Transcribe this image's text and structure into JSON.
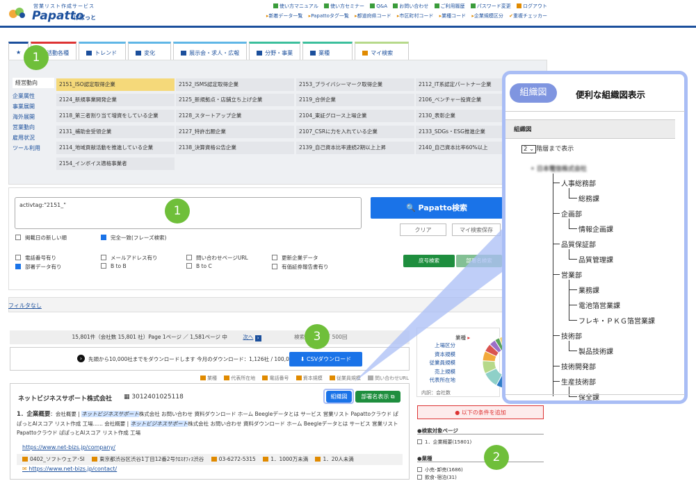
{
  "header": {
    "logo_sub": "営業リスト作成サービス",
    "logo_text": "Papatto",
    "logo_kana": "ぱぱっと",
    "links_row1": [
      "使い方マニュアル",
      "使い方セミナー",
      "Q&A",
      "お問い合わせ",
      "ご利用履歴",
      "パスワード変更",
      "ログアウト"
    ],
    "links_row2": [
      "新着データ一覧",
      "Papattoタグ一覧",
      "都道府県コード",
      "市区町村コード",
      "業種コード",
      "企業規模区分",
      "重複チェッカー"
    ]
  },
  "tabs": [
    {
      "label": "",
      "icon": "star-icon"
    },
    {
      "label": "活動各種",
      "icon": "grid-icon"
    },
    {
      "label": "トレンド",
      "icon": "chart-icon"
    },
    {
      "label": "変化",
      "icon": "chart-icon"
    },
    {
      "label": "展示会・求人・広報",
      "icon": "grid-icon"
    },
    {
      "label": "分野・事業",
      "icon": "grid-icon"
    },
    {
      "label": "業種",
      "icon": "building-icon"
    },
    {
      "label": "マイ検索",
      "icon": "person-icon"
    }
  ],
  "side_nav": [
    "経営動向",
    "企業属性",
    "事業展開",
    "海外展開",
    "営業動向",
    "雇用状況",
    "ツール利用"
  ],
  "tags": [
    [
      "2151_ISO認定取得企業",
      "2152_ISMS認定取得企業",
      "2153_プライバシーマーク取得企業",
      "2112_IT系認定パートナー企業"
    ],
    [
      "2124_新規事業開発企業",
      "2125_新規拠点・店舗立ち上げ企業",
      "2119_合併企業",
      "2106_ベンチャー投資企業"
    ],
    [
      "2118_第三者割り当て増資をしている企業",
      "2128_スタートアップ企業",
      "2104_東証グロース上場企業",
      "2130_表彰企業"
    ],
    [
      "2131_補助金受領企業",
      "2127_特許出願企業",
      "2107_CSRに力を入れている企業",
      "2133_SDGs・ESG推進企業"
    ],
    [
      "2114_地域貢献活動を推進している企業",
      "2138_決算資格公告企業",
      "2139_自己資本比率連続2期以上上昇",
      "2140_自己資本比率60%以上"
    ],
    [
      "2154_インボイス適格事業者"
    ]
  ],
  "search": {
    "query": "activtag:\"2151_\"",
    "button": "Papatto検索",
    "clear": "クリア",
    "save": "マイ検索保存",
    "opt_newest": "掲載日の新しい順",
    "opt_exact": "完全一致(フレーズ検索)",
    "checks": [
      [
        "電話番号有り",
        "メールアドレス有り",
        "問い合わせページURL",
        "更新企業データ"
      ],
      [
        "部署データ有り",
        "B to B",
        "B to C",
        "有価証券報告書有り"
      ]
    ],
    "btn_exact": "庶号検索",
    "btn_dept": "部署名検索"
  },
  "filter_link": "フィルタなし",
  "results": {
    "page_info": "15,801件（会社数 15,801 社）Page 1ページ ／ 1,581ページ 中",
    "next": "次へ",
    "search_count": "検索回数：2 ／ 500回",
    "download_note": "先頭から10,000社までをダウンロードします 今月のダウンロード：1,126社 / 100,000社",
    "csv_button": "CSVダウンロード",
    "legend": [
      "業種",
      "代表所在地",
      "電話番号",
      "資本規模",
      "従業員規模",
      "問い合わせURL"
    ]
  },
  "company": {
    "name": "ネットビジネスサポート株式会社",
    "id": "3012401025118",
    "btn_org": "組織図",
    "btn_dept": "部署名表示",
    "summary_num": "1．企業概要",
    "summary_a": "：会社概要 | ",
    "summary_hl1": "ネットビジネスサポート",
    "summary_b": "株式会社 お問い合わせ 資料ダウンロード ホーム Beegleデータとは サービス 営業リスト Papattoクラウド ぱぱっとAIスコア リスト作成 工場...... 会社概要 | ",
    "summary_hl2": "ネットビジネスサポート",
    "summary_c": "株式会社 お問い合わせ 資料ダウンロード ホーム Beegleデータとは サービス 営業リスト Papattoクラウド ぱぱっとAIスコア リスト作成 工場",
    "url": "https://www.net-bizs.jp/company/",
    "industry": "0402_ソフトウェア･SI",
    "address": "東京都渋谷区渋谷1丁目12番2号ｸﾛｽｵﾌｨｽ渋谷",
    "phone": "03-6272-5315",
    "capital": "1．1000万未満",
    "employees": "1．20人未満",
    "contact_url": "https://www.net-bizs.jp/contact/"
  },
  "sidebar": {
    "head": "業種",
    "links": [
      "上場区分",
      "資本規模",
      "従業員規模",
      "売上規模",
      "代表所在地"
    ],
    "note": "内訳：会社数",
    "donut_colors": [
      "#a9c7e8",
      "#2f7ec7",
      "#8fd0c8",
      "#b6d98a",
      "#f2a93b",
      "#d9534f",
      "#9b6fc7",
      "#5aa35a",
      "#f5d97a",
      "#e57fb0"
    ],
    "cond_button": "以下の条件を追加",
    "filter1_head": "●検索対象ページ",
    "filter1_item": "1．企業概要(15801)",
    "filter2_head": "●業種",
    "filter2_items": [
      "小売･卸売(1686)",
      "飲食･宿泊(31)"
    ]
  },
  "markers": [
    "1",
    "1",
    "3",
    "2"
  ],
  "callout": {
    "badge": "組織図",
    "title": "便利な組織図表示",
    "header": "組織図",
    "level": "2",
    "level_suffix": "階層まで表示",
    "root": "日本電信株式会社",
    "nodes": [
      {
        "label": "人事総務部",
        "depth": 1
      },
      {
        "label": "総務課",
        "depth": 2
      },
      {
        "label": "企画部",
        "depth": 1
      },
      {
        "label": "情報企画課",
        "depth": 2
      },
      {
        "label": "品質保証部",
        "depth": 1
      },
      {
        "label": "品質管理課",
        "depth": 2
      },
      {
        "label": "営業部",
        "depth": 1
      },
      {
        "label": "業務課",
        "depth": 2
      },
      {
        "label": "電池箔営業課",
        "depth": 2
      },
      {
        "label": "フレキ・ＰＫＧ箔営業課",
        "depth": 2
      },
      {
        "label": "技術部",
        "depth": 1
      },
      {
        "label": "製品技術課",
        "depth": 2
      },
      {
        "label": "技術開発部",
        "depth": 1
      },
      {
        "label": "生産技術部",
        "depth": 1
      },
      {
        "label": "保全課",
        "depth": 2
      }
    ]
  }
}
